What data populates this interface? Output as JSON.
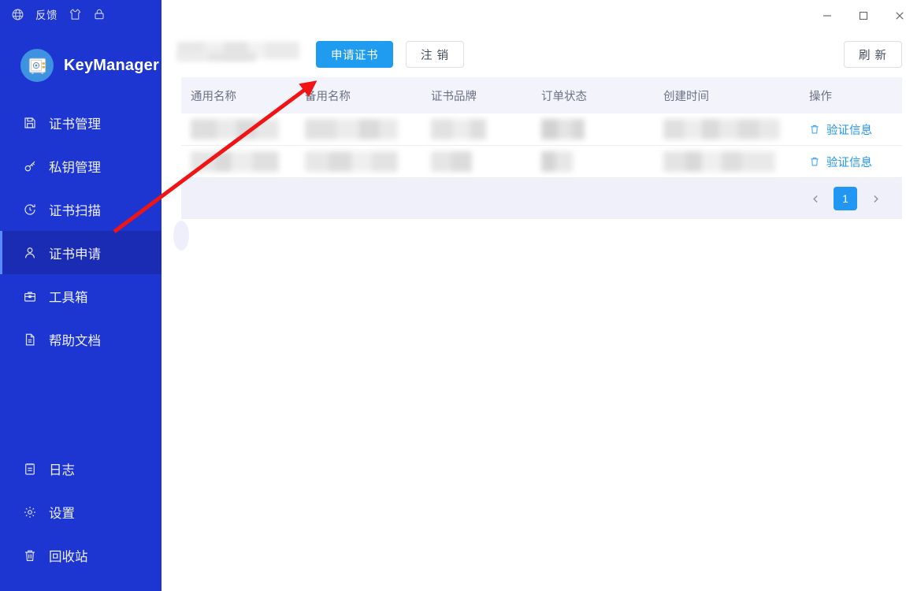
{
  "app": {
    "name": "KeyManager",
    "logo_icon": "safe-vault-icon"
  },
  "sidebar": {
    "topbar": {
      "globe_icon": "globe-icon",
      "feedback_label": "反馈",
      "theme_icon": "shirt-theme-icon",
      "lock_icon": "lock-icon"
    },
    "items": [
      {
        "label": "证书管理",
        "icon": "certificate-save-icon",
        "active": false
      },
      {
        "label": "私钥管理",
        "icon": "key-icon",
        "active": false
      },
      {
        "label": "证书扫描",
        "icon": "scan-clock-icon",
        "active": false
      },
      {
        "label": "证书申请",
        "icon": "user-icon",
        "active": true
      },
      {
        "label": "工具箱",
        "icon": "toolbox-icon",
        "active": false
      },
      {
        "label": "帮助文档",
        "icon": "document-icon",
        "active": false
      }
    ],
    "bottom_items": [
      {
        "label": "日志",
        "icon": "log-icon"
      },
      {
        "label": "设置",
        "icon": "gear-icon"
      },
      {
        "label": "回收站",
        "icon": "trash-icon"
      }
    ]
  },
  "titlebar": {
    "minimize_icon": "minimize-icon",
    "maximize_icon": "maximize-icon",
    "close_icon": "close-icon"
  },
  "toolbar": {
    "account_text_redacted": "",
    "apply_cert_label": "申请证书",
    "logout_label": "注 销",
    "refresh_label": "刷 新"
  },
  "table": {
    "columns": [
      "通用名称",
      "备用名称",
      "证书品牌",
      "订单状态",
      "创建时间",
      "操作"
    ],
    "rows": [
      {
        "common_name": "",
        "alt_name": "",
        "brand": "",
        "order_status": "",
        "created_at": "",
        "action_label": "验证信息",
        "action_icon": "trash-icon"
      },
      {
        "common_name": "",
        "alt_name": "",
        "brand": "",
        "order_status": "",
        "created_at": "",
        "action_label": "验证信息",
        "action_icon": "trash-icon"
      }
    ]
  },
  "pagination": {
    "prev_icon": "chevron-left-icon",
    "current_page": "1",
    "next_icon": "chevron-right-icon"
  },
  "annotation": {
    "type": "red-arrow",
    "color": "#f01414",
    "points_to": "申请证书"
  },
  "colors": {
    "sidebar_bg": "#1d35d1",
    "sidebar_active_bg": "#1a2cb4",
    "primary_button": "#1f9cf0",
    "link_blue": "#2196f3",
    "table_header_bg": "#f3f4fb",
    "pager_bg": "#f0f0fa",
    "annotation_red": "#f01414"
  }
}
